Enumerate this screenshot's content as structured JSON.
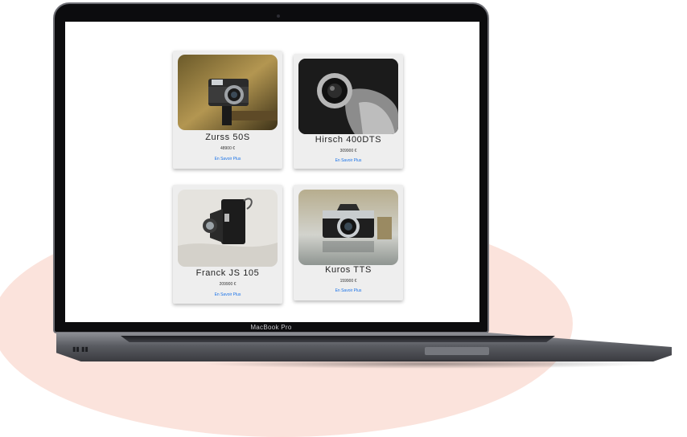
{
  "device": {
    "brand_label": "MacBook Pro"
  },
  "colors": {
    "background_blob": "#fbe3dc",
    "link": "#1a73e8",
    "card": "#eeeeee"
  },
  "products": [
    {
      "name": "Zurss 50S",
      "price": "48900 €",
      "link_label": "En Savoir Plus",
      "image": "camera-photo-vintage-rangefinder"
    },
    {
      "name": "Hirsch 400DTS",
      "price": "309900 €",
      "link_label": "En Savoir Plus",
      "image": "camera-photo-black-white"
    },
    {
      "name": "Franck JS 105",
      "price": "209900 €",
      "link_label": "En Savoir Plus",
      "image": "camera-photo-folding"
    },
    {
      "name": "Kuros TTS",
      "price": "159900 €",
      "link_label": "En Savoir Plus",
      "image": "camera-photo-slr"
    }
  ]
}
